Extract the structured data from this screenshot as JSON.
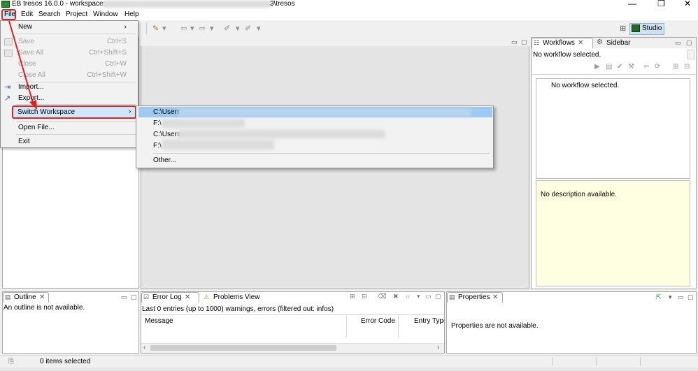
{
  "window": {
    "title_prefix": "EB tresos 16.0.0 - workspace:",
    "title_suffix": "3\\tresos",
    "minimize": "—",
    "maximize": "❐",
    "close": "✕"
  },
  "menubar": {
    "file": "File",
    "edit": "Edit",
    "search": "Search",
    "project": "Project",
    "window": "Window",
    "help": "Help"
  },
  "toolbar": {
    "perspective": "Studio"
  },
  "file_menu": {
    "new": "New",
    "save": "Save",
    "save_acc": "Ctrl+S",
    "save_all": "Save All",
    "save_all_acc": "Ctrl+Shift+S",
    "close": "Close",
    "close_acc": "Ctrl+W",
    "close_all": "Close All",
    "close_all_acc": "Ctrl+Shift+W",
    "import": "Import...",
    "export": "Export...",
    "switch_workspace": "Switch Workspace",
    "open_file": "Open File...",
    "exit": "Exit"
  },
  "switch_submenu": {
    "item1": "C:\\Users",
    "item2": "F:\\",
    "item3": "C:\\Users",
    "item4": "F:\\",
    "other": "Other..."
  },
  "workflows": {
    "tab_workflows": "Workflows",
    "tab_sidebar": "Sidebar",
    "status": "No workflow selected.",
    "tree_text": "No workflow selected.",
    "description": "No description available."
  },
  "outline": {
    "tab": "Outline",
    "text": "An outline is not available."
  },
  "error_log": {
    "tab": "Error Log",
    "tab2": "Problems View",
    "summary": "Last 0 entries (up to 1000) warnings, errors (filtered out: infos)",
    "columns": [
      "Message",
      "Error Code",
      "Entry Type"
    ]
  },
  "properties": {
    "tab": "Properties",
    "text": "Properties are not available."
  },
  "statusbar": {
    "text": "0 items selected"
  },
  "colors": {
    "accent_red": "#e0221c",
    "selection_blue": "#9ec9f0",
    "description_bg": "#ffffe1"
  }
}
